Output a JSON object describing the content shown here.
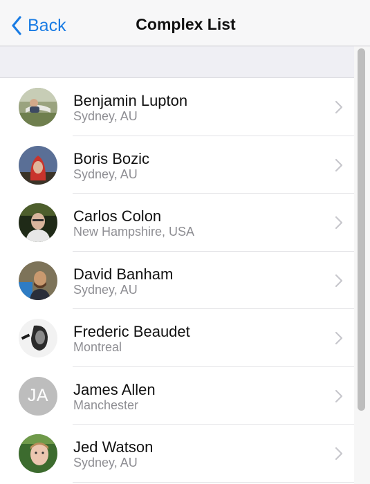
{
  "navbar": {
    "back_label": "Back",
    "title": "Complex List"
  },
  "contacts": [
    {
      "name": "Benjamin Lupton",
      "location": "Sydney, AU"
    },
    {
      "name": "Boris Bozic",
      "location": "Sydney, AU"
    },
    {
      "name": "Carlos Colon",
      "location": "New Hampshire, USA"
    },
    {
      "name": "David Banham",
      "location": "Sydney, AU"
    },
    {
      "name": "Frederic Beaudet",
      "location": "Montreal"
    },
    {
      "name": "James Allen",
      "location": "Manchester",
      "initials": "JA"
    },
    {
      "name": "Jed Watson",
      "location": "Sydney, AU"
    }
  ],
  "colors": {
    "accent": "#1a7ce4",
    "nav_background": "#f7f7f8",
    "section_header": "#efeff4",
    "secondary_text": "#8e8e93",
    "initials_avatar": "#bdbdbd"
  },
  "icons": {
    "back": "chevron-left-icon",
    "row_disclosure": "chevron-right-icon"
  }
}
